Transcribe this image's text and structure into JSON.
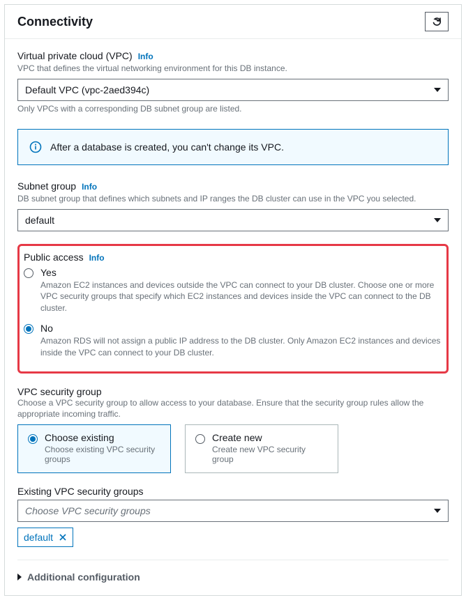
{
  "panel": {
    "title": "Connectivity"
  },
  "vpc": {
    "label": "Virtual private cloud (VPC)",
    "info": "Info",
    "hint": "VPC that defines the virtual networking environment for this DB instance.",
    "selected": "Default VPC (vpc-2aed394c)",
    "subtext": "Only VPCs with a corresponding DB subnet group are listed."
  },
  "alert": {
    "text": "After a database is created, you can't change its VPC."
  },
  "subnet": {
    "label": "Subnet group",
    "info": "Info",
    "hint": "DB subnet group that defines which subnets and IP ranges the DB cluster can use in the VPC you selected.",
    "selected": "default"
  },
  "publicAccess": {
    "label": "Public access",
    "info": "Info",
    "options": [
      {
        "label": "Yes",
        "desc": "Amazon EC2 instances and devices outside the VPC can connect to your DB cluster. Choose one or more VPC security groups that specify which EC2 instances and devices inside the VPC can connect to the DB cluster.",
        "selected": false
      },
      {
        "label": "No",
        "desc": "Amazon RDS will not assign a public IP address to the DB cluster. Only Amazon EC2 instances and devices inside the VPC can connect to your DB cluster.",
        "selected": true
      }
    ]
  },
  "secGroup": {
    "label": "VPC security group",
    "hint": "Choose a VPC security group to allow access to your database. Ensure that the security group rules allow the appropriate incoming traffic.",
    "cards": [
      {
        "title": "Choose existing",
        "desc": "Choose existing VPC security groups",
        "selected": true
      },
      {
        "title": "Create new",
        "desc": "Create new VPC security group",
        "selected": false
      }
    ]
  },
  "existingGroups": {
    "label": "Existing VPC security groups",
    "placeholder": "Choose VPC security groups",
    "token": "default"
  },
  "expander": {
    "label": "Additional configuration"
  }
}
